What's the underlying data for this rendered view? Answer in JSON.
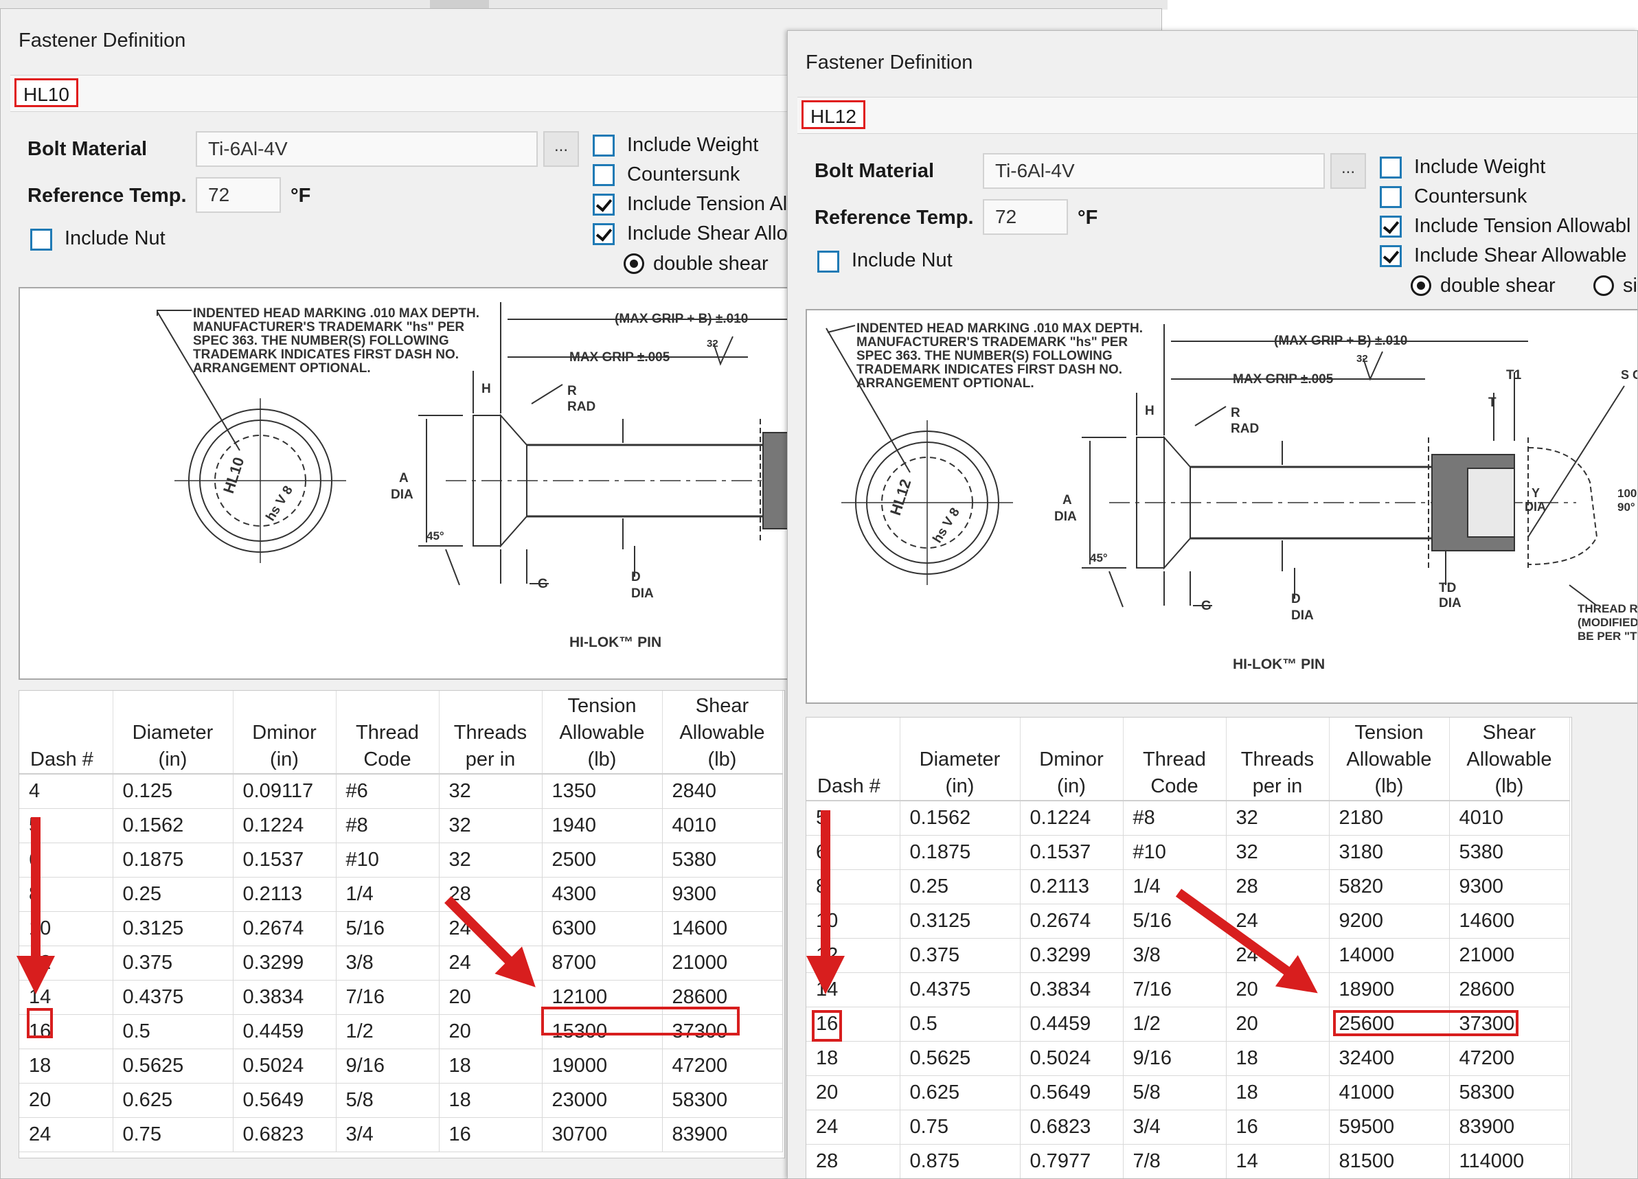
{
  "windows": [
    {
      "title": "Fastener Definition",
      "name": "HL10",
      "bolt_material_label": "Bolt Material",
      "bolt_material": "Ti-6Al-4V",
      "ellipsis": "...",
      "ref_temp_label": "Reference Temp.",
      "ref_temp": "72",
      "temp_unit": "°F",
      "include_nut": "Include Nut",
      "options": [
        {
          "label": "Include Weight",
          "checked": false
        },
        {
          "label": "Countersunk",
          "checked": false
        },
        {
          "label": "Include Tension Al",
          "checked": true
        },
        {
          "label": "Include Shear Allo",
          "checked": true
        }
      ],
      "radios": [
        {
          "label": "double shear",
          "selected": true
        }
      ],
      "drawing": {
        "note": [
          "INDENTED HEAD MARKING .010 MAX DEPTH.",
          "MANUFACTURER'S TRADEMARK \"hs\" PER",
          "SPEC 363. THE NUMBER(S) FOLLOWING",
          "TRADEMARK INDICATES FIRST DASH NO.",
          "ARRANGEMENT OPTIONAL."
        ],
        "max_grip_b": "(MAX GRIP + B) ±.010",
        "max_grip": "MAX GRIP ±.005",
        "r_rad": [
          "R",
          "RAD"
        ],
        "a_dia": [
          "A",
          "DIA"
        ],
        "d_dia": [
          "D",
          "DIA"
        ],
        "h": "H",
        "g": "G",
        "angle": "45°",
        "roughness": "32",
        "head_mark_num": "HL10",
        "head_mark_hs": "hs V 8",
        "caption": "HI-LOK™ PIN"
      },
      "table": {
        "headers": [
          [
            "Dash #"
          ],
          [
            "Diameter",
            "(in)"
          ],
          [
            "Dminor",
            "(in)"
          ],
          [
            "Thread",
            "Code"
          ],
          [
            "Threads",
            "per in"
          ],
          [
            "Tension",
            "Allowable",
            "(lb)"
          ],
          [
            "Shear",
            "Allowable",
            "(lb)"
          ]
        ],
        "rows": [
          [
            "4",
            "0.125",
            "0.09117",
            "#6",
            "32",
            "1350",
            "2840"
          ],
          [
            "5",
            "0.1562",
            "0.1224",
            "#8",
            "32",
            "1940",
            "4010"
          ],
          [
            "6",
            "0.1875",
            "0.1537",
            "#10",
            "32",
            "2500",
            "5380"
          ],
          [
            "8",
            "0.25",
            "0.2113",
            "1/4",
            "28",
            "4300",
            "9300"
          ],
          [
            "10",
            "0.3125",
            "0.2674",
            "5/16",
            "24",
            "6300",
            "14600"
          ],
          [
            "12",
            "0.375",
            "0.3299",
            "3/8",
            "24",
            "8700",
            "21000"
          ],
          [
            "14",
            "0.4375",
            "0.3834",
            "7/16",
            "20",
            "12100",
            "28600"
          ],
          [
            "16",
            "0.5",
            "0.4459",
            "1/2",
            "20",
            "15300",
            "37300"
          ],
          [
            "18",
            "0.5625",
            "0.5024",
            "9/16",
            "18",
            "19000",
            "47200"
          ],
          [
            "20",
            "0.625",
            "0.5649",
            "5/8",
            "18",
            "23000",
            "58300"
          ],
          [
            "24",
            "0.75",
            "0.6823",
            "3/4",
            "16",
            "30700",
            "83900"
          ]
        ]
      }
    },
    {
      "title": "Fastener Definition",
      "name": "HL12",
      "bolt_material_label": "Bolt Material",
      "bolt_material": "Ti-6Al-4V",
      "ellipsis": "...",
      "ref_temp_label": "Reference Temp.",
      "ref_temp": "72",
      "temp_unit": "°F",
      "include_nut": "Include Nut",
      "options": [
        {
          "label": "Include Weight",
          "checked": false
        },
        {
          "label": "Countersunk",
          "checked": false
        },
        {
          "label": "Include Tension Allowabl",
          "checked": true
        },
        {
          "label": "Include Shear Allowable",
          "checked": true
        }
      ],
      "radios": [
        {
          "label": "double shear",
          "selected": true
        },
        {
          "label": "si",
          "selected": false
        }
      ],
      "drawing": {
        "note": [
          "INDENTED HEAD MARKING .010 MAX DEPTH.",
          "MANUFACTURER'S TRADEMARK \"hs\" PER",
          "SPEC 363. THE NUMBER(S) FOLLOWING",
          "TRADEMARK INDICATES FIRST DASH NO.",
          "ARRANGEMENT OPTIONAL."
        ],
        "max_grip_b": "(MAX GRIP + B) ±.010",
        "max_grip": "MAX GRIP ±.005",
        "r_rad": [
          "R",
          "RAD"
        ],
        "a_dia": [
          "A",
          "DIA"
        ],
        "d_dia": [
          "D",
          "DIA"
        ],
        "h": "H",
        "g": "G",
        "angle": "45°",
        "roughness": "32",
        "head_mark_num": "HL12",
        "head_mark_hs": "hs V 8",
        "caption": "HI-LOK™ PIN",
        "t1": "T1",
        "t": "T",
        "y_dia": [
          "Y",
          "DIA"
        ],
        "td_dia": [
          "TD",
          "DIA"
        ],
        "s_c": "S C",
        "angle2": [
          "100",
          "90°"
        ],
        "thread_note": [
          "THREAD ROLL",
          "(MODIFIED). M",
          "BE PER \"TD\""
        ]
      },
      "table": {
        "headers": [
          [
            "Dash #"
          ],
          [
            "Diameter",
            "(in)"
          ],
          [
            "Dminor",
            "(in)"
          ],
          [
            "Thread",
            "Code"
          ],
          [
            "Threads",
            "per in"
          ],
          [
            "Tension",
            "Allowable",
            "(lb)"
          ],
          [
            "Shear",
            "Allowable",
            "(lb)"
          ]
        ],
        "rows": [
          [
            "5",
            "0.1562",
            "0.1224",
            "#8",
            "32",
            "2180",
            "4010"
          ],
          [
            "6",
            "0.1875",
            "0.1537",
            "#10",
            "32",
            "3180",
            "5380"
          ],
          [
            "8",
            "0.25",
            "0.2113",
            "1/4",
            "28",
            "5820",
            "9300"
          ],
          [
            "10",
            "0.3125",
            "0.2674",
            "5/16",
            "24",
            "9200",
            "14600"
          ],
          [
            "12",
            "0.375",
            "0.3299",
            "3/8",
            "24",
            "14000",
            "21000"
          ],
          [
            "14",
            "0.4375",
            "0.3834",
            "7/16",
            "20",
            "18900",
            "28600"
          ],
          [
            "16",
            "0.5",
            "0.4459",
            "1/2",
            "20",
            "25600",
            "37300"
          ],
          [
            "18",
            "0.5625",
            "0.5024",
            "9/16",
            "18",
            "32400",
            "47200"
          ],
          [
            "20",
            "0.625",
            "0.5649",
            "5/8",
            "18",
            "41000",
            "58300"
          ],
          [
            "24",
            "0.75",
            "0.6823",
            "3/4",
            "16",
            "59500",
            "83900"
          ],
          [
            "28",
            "0.875",
            "0.7977",
            "7/8",
            "14",
            "81500",
            "114000"
          ]
        ]
      }
    }
  ],
  "annotation_color": "#d81e1e"
}
